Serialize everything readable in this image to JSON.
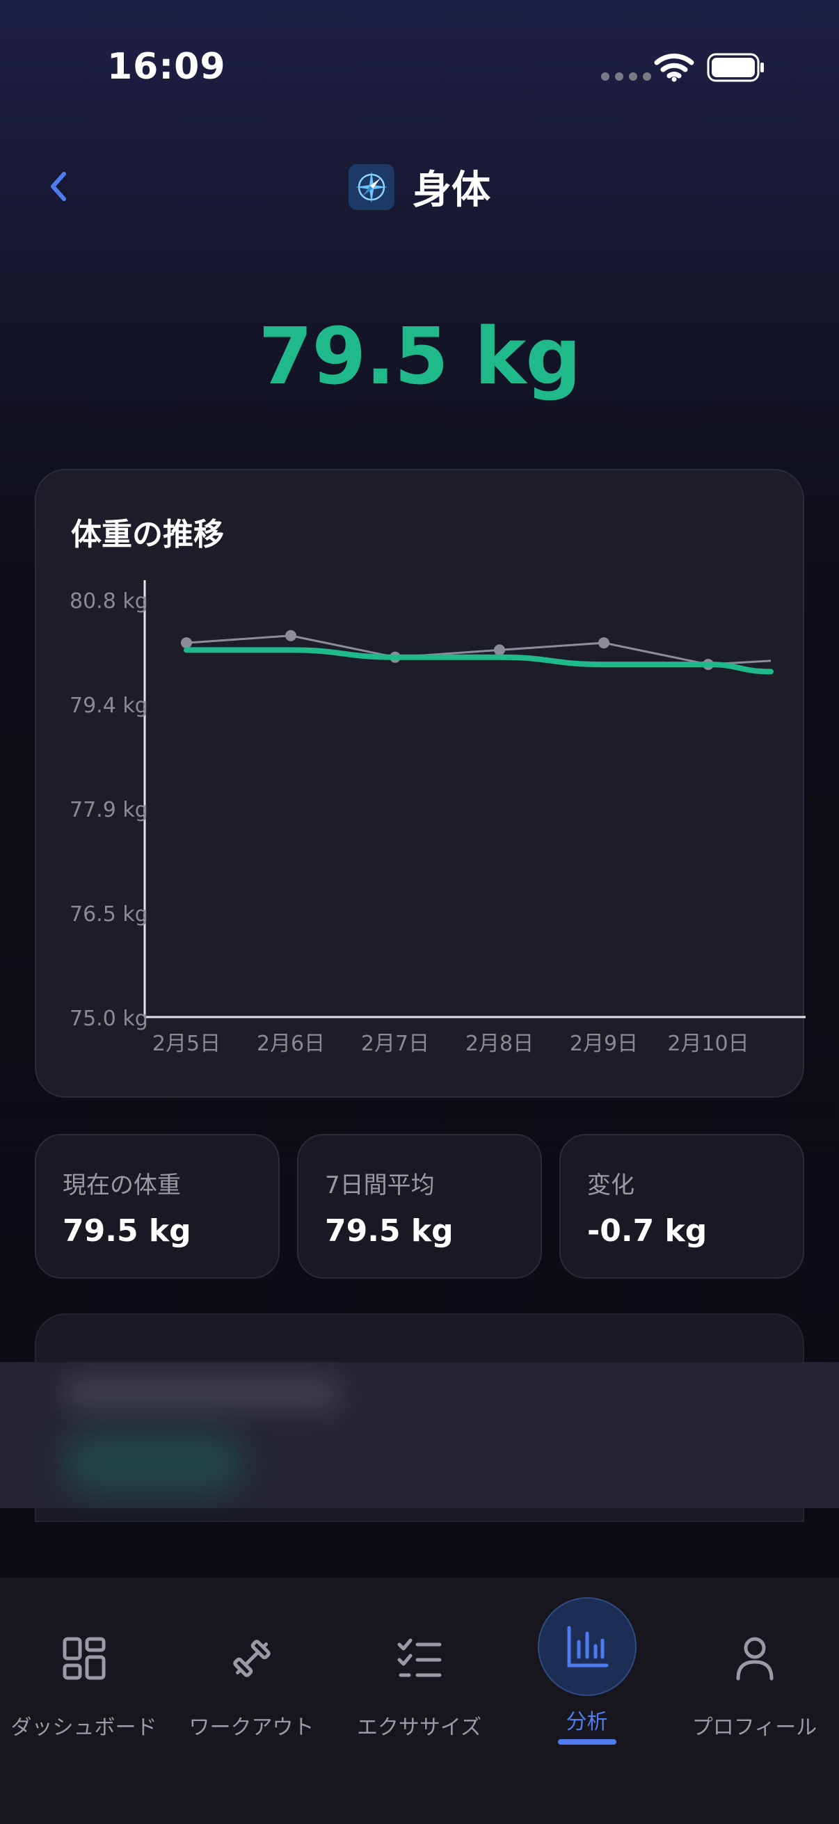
{
  "status_bar": {
    "time": "16:09"
  },
  "nav": {
    "title": "身体"
  },
  "current_weight_display": "79.5 kg",
  "chart_card": {
    "title": "体重の推移"
  },
  "chart_data": {
    "type": "line",
    "title": "体重の推移",
    "categories": [
      "2月5日",
      "2月6日",
      "2月7日",
      "2月8日",
      "2月9日",
      "2月10日"
    ],
    "y_tick_labels": [
      "80.8 kg",
      "79.4 kg",
      "77.9 kg",
      "76.5 kg",
      "75.0 kg"
    ],
    "ylim": [
      75.0,
      80.8
    ],
    "series": [
      {
        "x": [
          0,
          1,
          2,
          3,
          4,
          5,
          5.6
        ],
        "values": [
          80.2,
          80.3,
          80.0,
          80.1,
          80.2,
          79.9,
          79.95
        ],
        "style": "raw"
      },
      {
        "x": [
          0,
          1,
          2,
          3,
          4,
          5,
          5.6
        ],
        "values": [
          80.1,
          80.1,
          80.0,
          80.0,
          79.9,
          79.9,
          79.8
        ],
        "style": "trend"
      }
    ],
    "colors": {
      "raw": "#8d8d99",
      "trend": "#1fb98a"
    },
    "grid": false
  },
  "stats": [
    {
      "label": "現在の体重",
      "value": "79.5 kg"
    },
    {
      "label": "7日間平均",
      "value": "79.5 kg"
    },
    {
      "label": "変化",
      "value": "-0.7 kg"
    }
  ],
  "tabs": [
    {
      "label": "ダッシュボード",
      "icon": "dashboard-icon",
      "active": false
    },
    {
      "label": "ワークアウト",
      "icon": "dumbbell-icon",
      "active": false
    },
    {
      "label": "エクササイズ",
      "icon": "checklist-icon",
      "active": false
    },
    {
      "label": "分析",
      "icon": "bar-chart-icon",
      "active": true
    },
    {
      "label": "プロフィール",
      "icon": "person-icon",
      "active": false
    }
  ],
  "colors": {
    "accent": "#4e7cf0",
    "weight_green": "#1fb98a"
  }
}
